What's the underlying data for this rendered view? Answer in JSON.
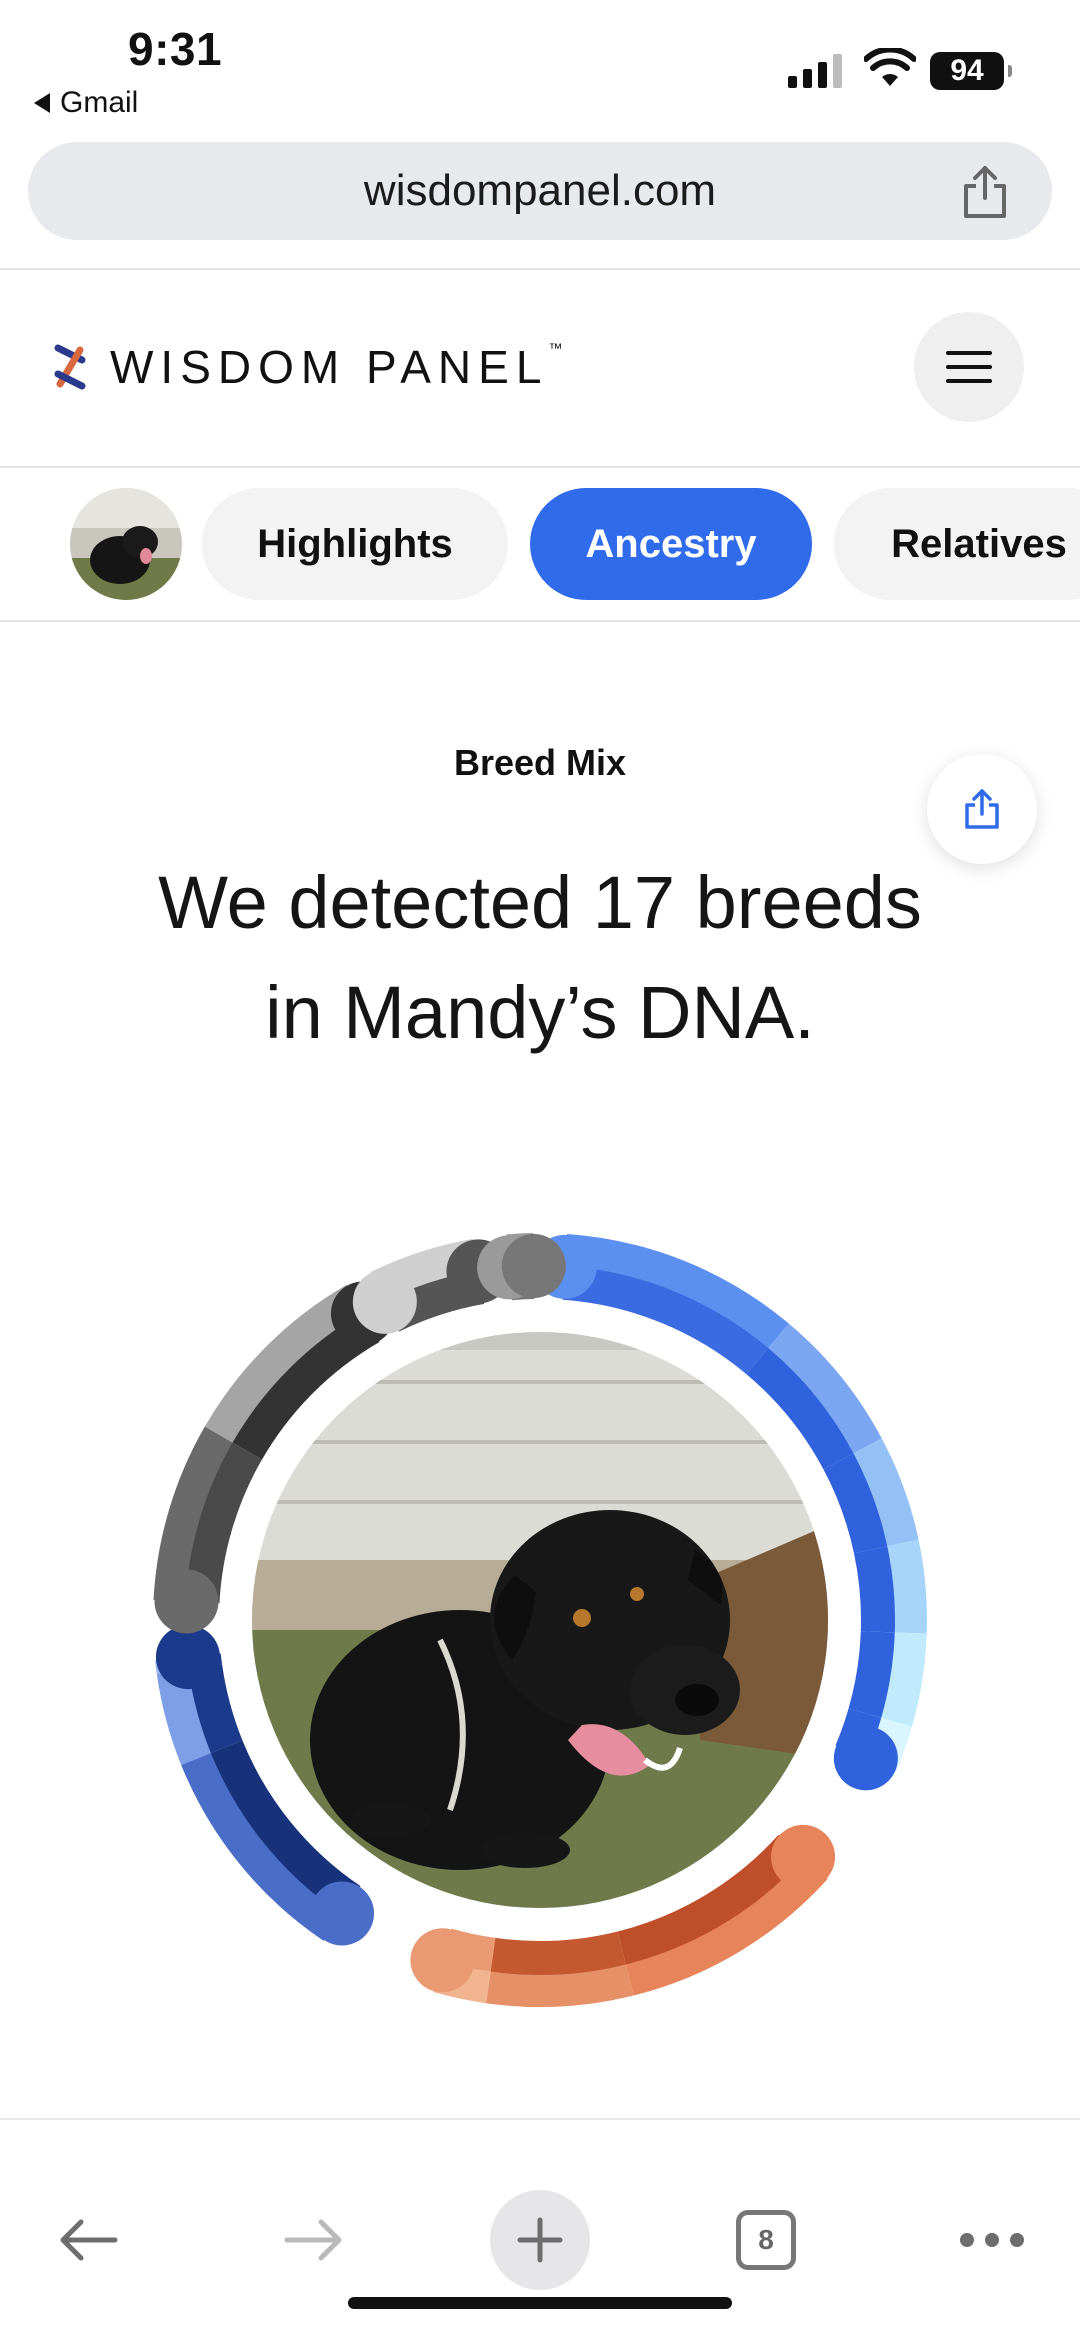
{
  "status": {
    "time": "9:31",
    "back_app": "Gmail",
    "battery": "94"
  },
  "browser": {
    "url": "wisdompanel.com",
    "tab_count": "8"
  },
  "header": {
    "logo_text": "WISDOM PANEL",
    "logo_tm": "™"
  },
  "tabs": [
    {
      "label": "Highlights",
      "active": false
    },
    {
      "label": "Ancestry",
      "active": true
    },
    {
      "label": "Relatives",
      "active": false
    }
  ],
  "main": {
    "section_label": "Breed Mix",
    "headline_line1": "We detected 17 breeds",
    "headline_line2": "in Mandy’s DNA."
  },
  "colors": {
    "accent": "#2f6bea",
    "blue": "#3b6fe0",
    "orange": "#d9683f",
    "gray": "#555555"
  }
}
